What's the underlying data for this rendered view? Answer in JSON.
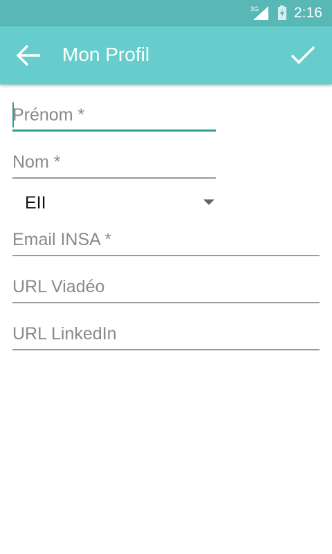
{
  "status_bar": {
    "network": "3G",
    "time": "2:16"
  },
  "app_bar": {
    "title": "Mon Profil"
  },
  "form": {
    "prenom": {
      "placeholder": "Prénom *",
      "value": ""
    },
    "nom": {
      "placeholder": "Nom *",
      "value": ""
    },
    "department": {
      "selected": "EII"
    },
    "email": {
      "placeholder": "Email INSA *",
      "value": ""
    },
    "viadeo": {
      "placeholder": "URL Viadéo",
      "value": ""
    },
    "linkedin": {
      "placeholder": "URL LinkedIn",
      "value": ""
    }
  },
  "colors": {
    "status_bar": "#59b8b6",
    "app_bar": "#66cccc",
    "accent": "#2a9e93"
  }
}
